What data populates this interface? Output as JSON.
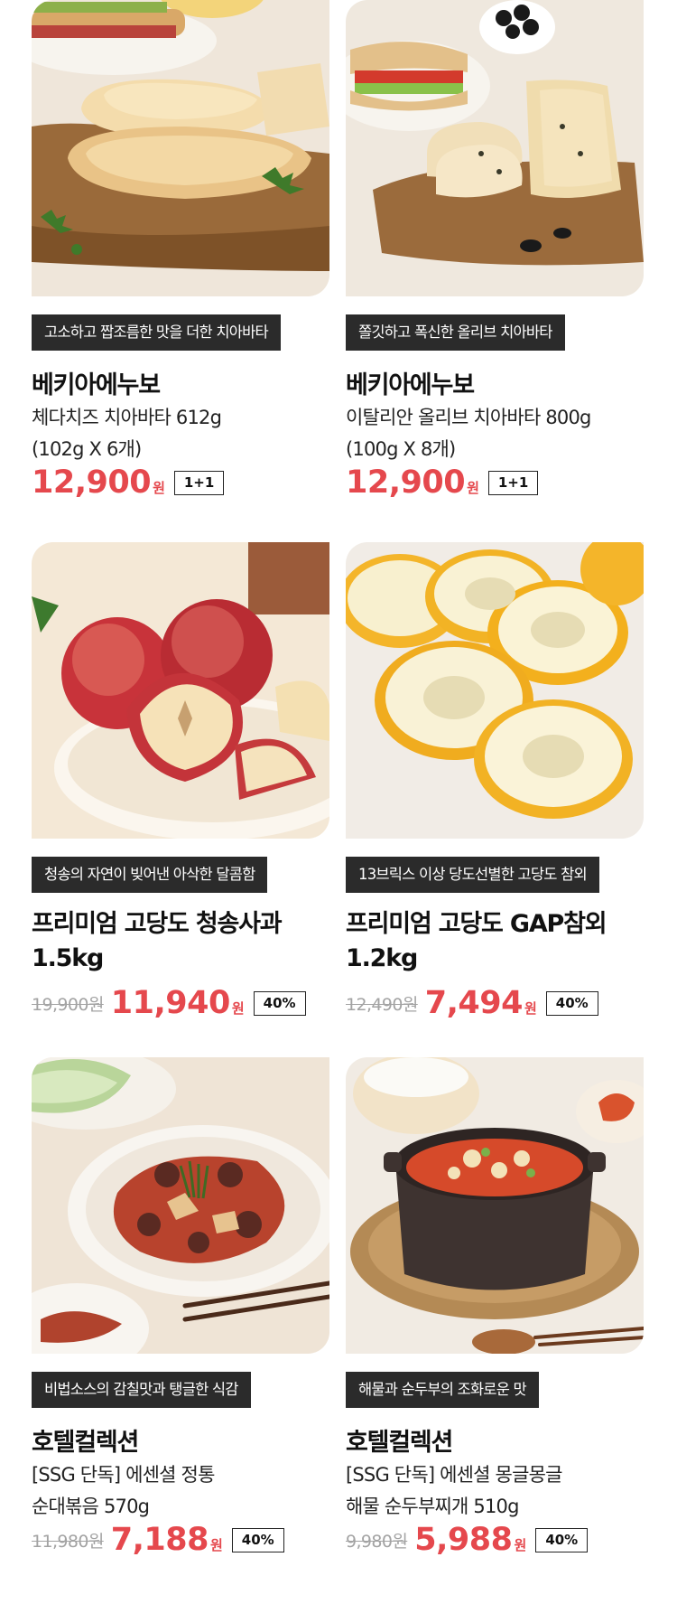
{
  "products": [
    {
      "tag": "고소하고 짭조름한 맛을 더한 치아바타",
      "brand": "베키아에누보",
      "name_line1": "체다치즈 치아바타 612g",
      "name_line2": "(102g X 6개)",
      "price": "12,900",
      "currency": "원",
      "badge": "1+1",
      "image": "ciabatta-cheddar-photo"
    },
    {
      "tag": "쫄깃하고 폭신한 올리브 치아바타",
      "brand": "베키아에누보",
      "name_line1": "이탈리안 올리브 치아바타 800g",
      "name_line2": "(100g X 8개)",
      "price": "12,900",
      "currency": "원",
      "badge": "1+1",
      "image": "ciabatta-olive-photo"
    },
    {
      "tag": "청송의 자연이 빚어낸 아삭한 달콤함",
      "name_line1": "프리미엄 고당도 청송사과",
      "name_line2": "1.5kg",
      "original_price": "19,900원",
      "price": "11,940",
      "currency": "원",
      "badge": "40%",
      "image": "apple-photo"
    },
    {
      "tag": "13브릭스 이상 당도선별한 고당도 참외",
      "name_line1": "프리미엄 고당도 GAP참외",
      "name_line2": "1.2kg",
      "original_price": "12,490원",
      "price": "7,494",
      "currency": "원",
      "badge": "40%",
      "image": "korean-melon-photo"
    },
    {
      "tag": "비법소스의 감칠맛과 탱글한 식감",
      "brand": "호텔컬렉션",
      "name_line1": "[SSG 단독] 에센셜 정통",
      "name_line2": "순대볶음 570g",
      "original_price": "11,980원",
      "price": "7,188",
      "currency": "원",
      "badge": "40%",
      "image": "sundae-stirfry-photo"
    },
    {
      "tag": "해물과 순두부의 조화로운 맛",
      "brand": "호텔컬렉션",
      "name_line1": "[SSG 단독] 에센셜 몽글몽글",
      "name_line2": "해물 순두부찌개 510g",
      "original_price": "9,980원",
      "price": "5,988",
      "currency": "원",
      "badge": "40%",
      "image": "sundubu-stew-photo"
    }
  ]
}
